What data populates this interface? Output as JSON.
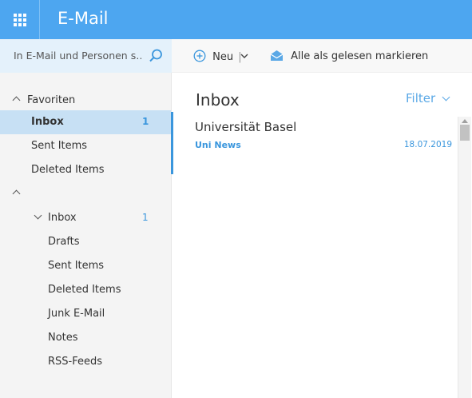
{
  "app": {
    "title": "E-Mail",
    "launcher_icon": "app-launcher-icon"
  },
  "search": {
    "placeholder": "In E-Mail und Personen s…",
    "icon": "search-icon"
  },
  "toolbar": {
    "new_label": "Neu",
    "new_separator": "|",
    "mark_all_read_label": "Alle als gelesen markieren"
  },
  "sidebar": {
    "favorites": {
      "header": "Favoriten",
      "items": [
        {
          "label": "Inbox",
          "count": "1",
          "selected": true
        },
        {
          "label": "Sent Items",
          "count": ""
        },
        {
          "label": "Deleted Items",
          "count": ""
        }
      ]
    },
    "account": {
      "header": "",
      "folders": [
        {
          "label": "Inbox",
          "count": "1",
          "expandable": true
        },
        {
          "label": "Drafts",
          "count": ""
        },
        {
          "label": "Sent Items",
          "count": ""
        },
        {
          "label": "Deleted Items",
          "count": ""
        },
        {
          "label": "Junk E-Mail",
          "count": ""
        },
        {
          "label": "Notes",
          "count": ""
        },
        {
          "label": "RSS-Feeds",
          "count": ""
        }
      ]
    }
  },
  "message_list": {
    "title": "Inbox",
    "filter_label": "Filter",
    "messages": [
      {
        "sender": "Universität Basel",
        "subject": "Uni News",
        "date": "18.07.2019"
      }
    ]
  },
  "colors": {
    "header_bg": "#4da6f0",
    "accent": "#3a96dd",
    "selected_bg": "#c7e0f4",
    "search_bg": "#e4f1fb"
  }
}
